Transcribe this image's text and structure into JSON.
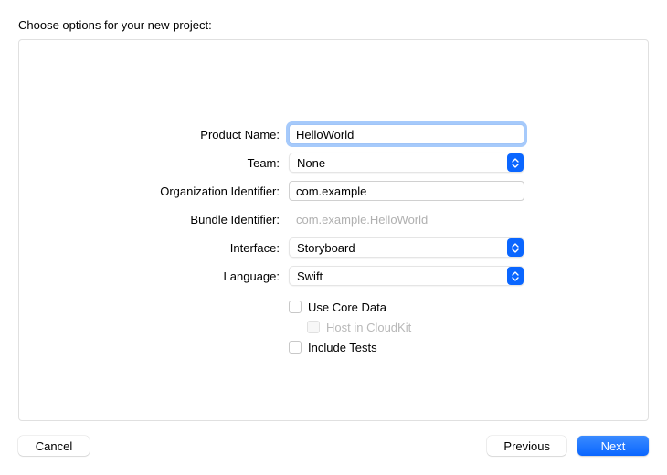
{
  "dialog": {
    "title": "Choose options for your new project:"
  },
  "form": {
    "product_name": {
      "label": "Product Name:",
      "value": "HelloWorld"
    },
    "team": {
      "label": "Team:",
      "value": "None"
    },
    "org_identifier": {
      "label": "Organization Identifier:",
      "value": "com.example"
    },
    "bundle_identifier": {
      "label": "Bundle Identifier:",
      "value": "com.example.HelloWorld"
    },
    "interface": {
      "label": "Interface:",
      "value": "Storyboard"
    },
    "language": {
      "label": "Language:",
      "value": "Swift"
    },
    "use_core_data": {
      "label": "Use Core Data",
      "checked": false
    },
    "host_in_cloudkit": {
      "label": "Host in CloudKit",
      "checked": false,
      "enabled": false
    },
    "include_tests": {
      "label": "Include Tests",
      "checked": false
    }
  },
  "buttons": {
    "cancel": "Cancel",
    "previous": "Previous",
    "next": "Next"
  },
  "colors": {
    "accent": "#0a66ff"
  }
}
